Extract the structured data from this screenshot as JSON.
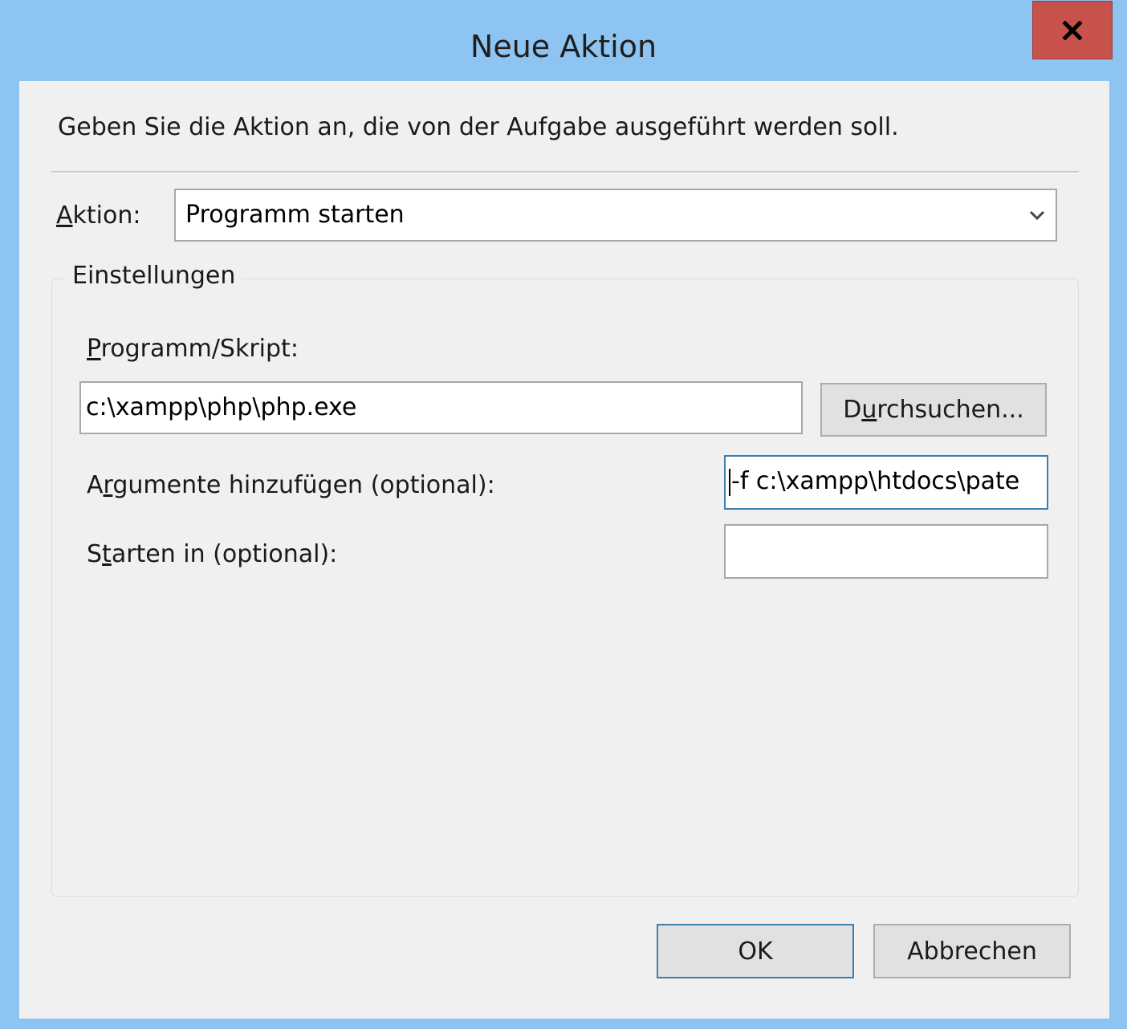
{
  "window": {
    "title": "Neue Aktion",
    "close_label": "x"
  },
  "dialog": {
    "instruction": "Geben Sie die Aktion an, die von der Aufgabe ausgeführt werden soll.",
    "action_label_first": "A",
    "action_label_rest": "ktion:",
    "action_value": "Programm starten",
    "group_title": "Einstellungen",
    "program_label_first": "P",
    "program_label_rest": "rogramm/Skript:",
    "program_value": "c:\\xampp\\php\\php.exe",
    "browse_pre": "D",
    "browse_u": "u",
    "browse_post": "rchsuchen...",
    "args_label_pre": "A",
    "args_label_u": "r",
    "args_label_post": "gumente hinzufügen (optional):",
    "args_value": "-f c:\\xampp\\htdocs\\pate",
    "start_label_pre": "S",
    "start_label_u": "t",
    "start_label_post": "arten in (optional):",
    "start_value": "",
    "ok_label": "OK",
    "cancel_label": "Abbrechen"
  },
  "colors": {
    "titlebar": "#8ec4f1",
    "close": "#c7514b",
    "client": "#f0f0f0",
    "focus_border": "#3c7fb1"
  },
  "icons": {
    "close": "close-icon",
    "combo": "chevron-down-icon"
  }
}
